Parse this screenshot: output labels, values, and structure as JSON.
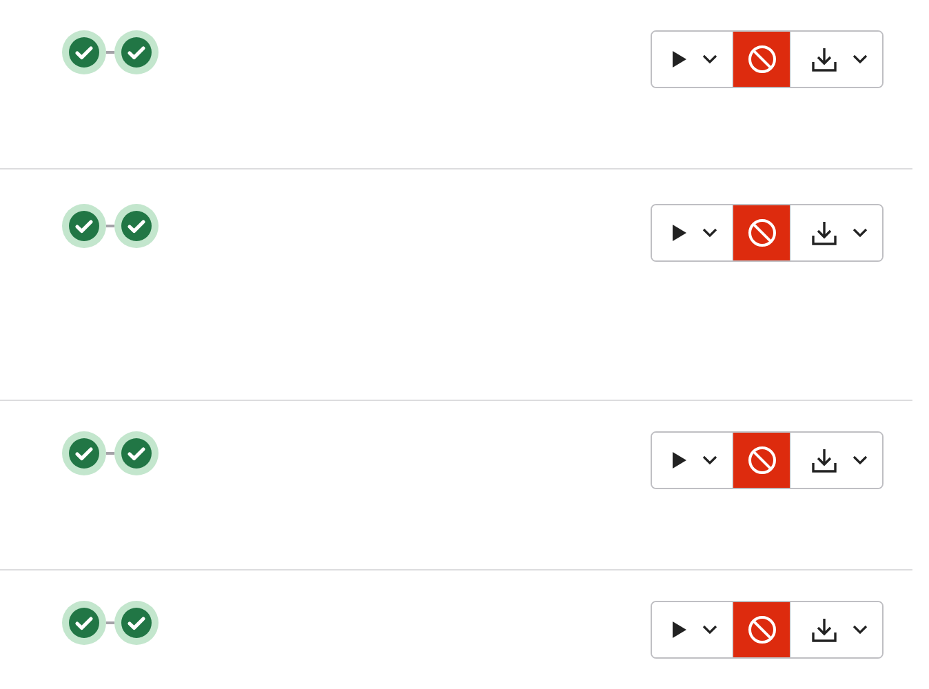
{
  "rows": [
    {
      "stages": [
        {
          "kind": "passed"
        },
        {
          "kind": "passed"
        }
      ],
      "actions": [
        {
          "kind": "play",
          "dropdown": true
        },
        {
          "kind": "cancel",
          "dropdown": false
        },
        {
          "kind": "download",
          "dropdown": true
        }
      ]
    },
    {
      "stages": [
        {
          "kind": "passed"
        },
        {
          "kind": "passed"
        }
      ],
      "actions": [
        {
          "kind": "play",
          "dropdown": true
        },
        {
          "kind": "cancel",
          "dropdown": false
        },
        {
          "kind": "download",
          "dropdown": true
        }
      ]
    },
    {
      "stages": [
        {
          "kind": "passed"
        },
        {
          "kind": "passed"
        }
      ],
      "actions": [
        {
          "kind": "play",
          "dropdown": true
        },
        {
          "kind": "cancel",
          "dropdown": false
        },
        {
          "kind": "download",
          "dropdown": true
        }
      ]
    },
    {
      "stages": [
        {
          "kind": "passed"
        },
        {
          "kind": "passed"
        }
      ],
      "actions": [
        {
          "kind": "play",
          "dropdown": true
        },
        {
          "kind": "cancel",
          "dropdown": false
        },
        {
          "kind": "download",
          "dropdown": true
        }
      ]
    }
  ]
}
